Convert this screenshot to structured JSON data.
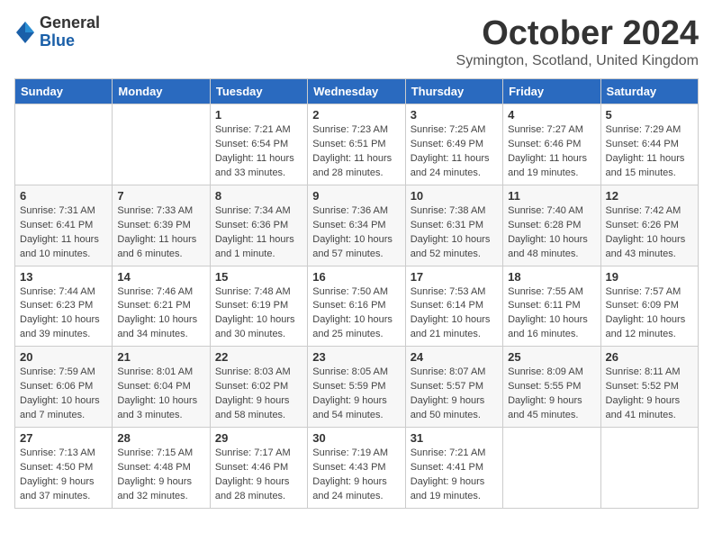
{
  "logo": {
    "general": "General",
    "blue": "Blue"
  },
  "title": "October 2024",
  "subtitle": "Symington, Scotland, United Kingdom",
  "days_of_week": [
    "Sunday",
    "Monday",
    "Tuesday",
    "Wednesday",
    "Thursday",
    "Friday",
    "Saturday"
  ],
  "weeks": [
    [
      {
        "day": "",
        "sunrise": "",
        "sunset": "",
        "daylight": ""
      },
      {
        "day": "",
        "sunrise": "",
        "sunset": "",
        "daylight": ""
      },
      {
        "day": "1",
        "sunrise": "Sunrise: 7:21 AM",
        "sunset": "Sunset: 6:54 PM",
        "daylight": "Daylight: 11 hours and 33 minutes."
      },
      {
        "day": "2",
        "sunrise": "Sunrise: 7:23 AM",
        "sunset": "Sunset: 6:51 PM",
        "daylight": "Daylight: 11 hours and 28 minutes."
      },
      {
        "day": "3",
        "sunrise": "Sunrise: 7:25 AM",
        "sunset": "Sunset: 6:49 PM",
        "daylight": "Daylight: 11 hours and 24 minutes."
      },
      {
        "day": "4",
        "sunrise": "Sunrise: 7:27 AM",
        "sunset": "Sunset: 6:46 PM",
        "daylight": "Daylight: 11 hours and 19 minutes."
      },
      {
        "day": "5",
        "sunrise": "Sunrise: 7:29 AM",
        "sunset": "Sunset: 6:44 PM",
        "daylight": "Daylight: 11 hours and 15 minutes."
      }
    ],
    [
      {
        "day": "6",
        "sunrise": "Sunrise: 7:31 AM",
        "sunset": "Sunset: 6:41 PM",
        "daylight": "Daylight: 11 hours and 10 minutes."
      },
      {
        "day": "7",
        "sunrise": "Sunrise: 7:33 AM",
        "sunset": "Sunset: 6:39 PM",
        "daylight": "Daylight: 11 hours and 6 minutes."
      },
      {
        "day": "8",
        "sunrise": "Sunrise: 7:34 AM",
        "sunset": "Sunset: 6:36 PM",
        "daylight": "Daylight: 11 hours and 1 minute."
      },
      {
        "day": "9",
        "sunrise": "Sunrise: 7:36 AM",
        "sunset": "Sunset: 6:34 PM",
        "daylight": "Daylight: 10 hours and 57 minutes."
      },
      {
        "day": "10",
        "sunrise": "Sunrise: 7:38 AM",
        "sunset": "Sunset: 6:31 PM",
        "daylight": "Daylight: 10 hours and 52 minutes."
      },
      {
        "day": "11",
        "sunrise": "Sunrise: 7:40 AM",
        "sunset": "Sunset: 6:28 PM",
        "daylight": "Daylight: 10 hours and 48 minutes."
      },
      {
        "day": "12",
        "sunrise": "Sunrise: 7:42 AM",
        "sunset": "Sunset: 6:26 PM",
        "daylight": "Daylight: 10 hours and 43 minutes."
      }
    ],
    [
      {
        "day": "13",
        "sunrise": "Sunrise: 7:44 AM",
        "sunset": "Sunset: 6:23 PM",
        "daylight": "Daylight: 10 hours and 39 minutes."
      },
      {
        "day": "14",
        "sunrise": "Sunrise: 7:46 AM",
        "sunset": "Sunset: 6:21 PM",
        "daylight": "Daylight: 10 hours and 34 minutes."
      },
      {
        "day": "15",
        "sunrise": "Sunrise: 7:48 AM",
        "sunset": "Sunset: 6:19 PM",
        "daylight": "Daylight: 10 hours and 30 minutes."
      },
      {
        "day": "16",
        "sunrise": "Sunrise: 7:50 AM",
        "sunset": "Sunset: 6:16 PM",
        "daylight": "Daylight: 10 hours and 25 minutes."
      },
      {
        "day": "17",
        "sunrise": "Sunrise: 7:53 AM",
        "sunset": "Sunset: 6:14 PM",
        "daylight": "Daylight: 10 hours and 21 minutes."
      },
      {
        "day": "18",
        "sunrise": "Sunrise: 7:55 AM",
        "sunset": "Sunset: 6:11 PM",
        "daylight": "Daylight: 10 hours and 16 minutes."
      },
      {
        "day": "19",
        "sunrise": "Sunrise: 7:57 AM",
        "sunset": "Sunset: 6:09 PM",
        "daylight": "Daylight: 10 hours and 12 minutes."
      }
    ],
    [
      {
        "day": "20",
        "sunrise": "Sunrise: 7:59 AM",
        "sunset": "Sunset: 6:06 PM",
        "daylight": "Daylight: 10 hours and 7 minutes."
      },
      {
        "day": "21",
        "sunrise": "Sunrise: 8:01 AM",
        "sunset": "Sunset: 6:04 PM",
        "daylight": "Daylight: 10 hours and 3 minutes."
      },
      {
        "day": "22",
        "sunrise": "Sunrise: 8:03 AM",
        "sunset": "Sunset: 6:02 PM",
        "daylight": "Daylight: 9 hours and 58 minutes."
      },
      {
        "day": "23",
        "sunrise": "Sunrise: 8:05 AM",
        "sunset": "Sunset: 5:59 PM",
        "daylight": "Daylight: 9 hours and 54 minutes."
      },
      {
        "day": "24",
        "sunrise": "Sunrise: 8:07 AM",
        "sunset": "Sunset: 5:57 PM",
        "daylight": "Daylight: 9 hours and 50 minutes."
      },
      {
        "day": "25",
        "sunrise": "Sunrise: 8:09 AM",
        "sunset": "Sunset: 5:55 PM",
        "daylight": "Daylight: 9 hours and 45 minutes."
      },
      {
        "day": "26",
        "sunrise": "Sunrise: 8:11 AM",
        "sunset": "Sunset: 5:52 PM",
        "daylight": "Daylight: 9 hours and 41 minutes."
      }
    ],
    [
      {
        "day": "27",
        "sunrise": "Sunrise: 7:13 AM",
        "sunset": "Sunset: 4:50 PM",
        "daylight": "Daylight: 9 hours and 37 minutes."
      },
      {
        "day": "28",
        "sunrise": "Sunrise: 7:15 AM",
        "sunset": "Sunset: 4:48 PM",
        "daylight": "Daylight: 9 hours and 32 minutes."
      },
      {
        "day": "29",
        "sunrise": "Sunrise: 7:17 AM",
        "sunset": "Sunset: 4:46 PM",
        "daylight": "Daylight: 9 hours and 28 minutes."
      },
      {
        "day": "30",
        "sunrise": "Sunrise: 7:19 AM",
        "sunset": "Sunset: 4:43 PM",
        "daylight": "Daylight: 9 hours and 24 minutes."
      },
      {
        "day": "31",
        "sunrise": "Sunrise: 7:21 AM",
        "sunset": "Sunset: 4:41 PM",
        "daylight": "Daylight: 9 hours and 19 minutes."
      },
      {
        "day": "",
        "sunrise": "",
        "sunset": "",
        "daylight": ""
      },
      {
        "day": "",
        "sunrise": "",
        "sunset": "",
        "daylight": ""
      }
    ]
  ]
}
